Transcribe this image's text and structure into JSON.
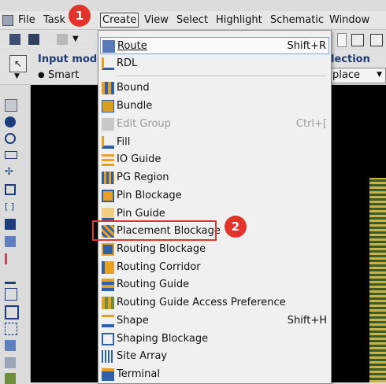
{
  "menubar": {
    "items": [
      "File",
      "Task",
      "Create",
      "View",
      "Select",
      "Highlight",
      "Schematic",
      "Window"
    ],
    "active": "Create"
  },
  "toolbar": {
    "input_mode_label": "Input mode",
    "input_mode_value": "Smart",
    "selection_label": "lection",
    "selection_value": "place"
  },
  "menu": {
    "items": [
      {
        "label": "Route",
        "shortcut": "Shift+R",
        "icon": "route-icon",
        "mnemonic": "R"
      },
      {
        "label": "RDL",
        "shortcut": "",
        "icon": "rdl-icon",
        "mnemonic": "R"
      },
      {
        "label": "Bound",
        "shortcut": "",
        "icon": "bound-icon",
        "mnemonic": "B"
      },
      {
        "label": "Bundle",
        "shortcut": "",
        "icon": "bundle-icon",
        "mnemonic": "B"
      },
      {
        "label": "Edit Group",
        "shortcut": "Ctrl+[",
        "icon": "edit-group-icon",
        "disabled": true
      },
      {
        "label": "Fill",
        "shortcut": "",
        "icon": "fill-icon"
      },
      {
        "label": "IO Guide",
        "shortcut": "",
        "icon": "io-guide-icon"
      },
      {
        "label": "PG Region",
        "shortcut": "",
        "icon": "pg-region-icon"
      },
      {
        "label": "Pin Blockage",
        "shortcut": "",
        "icon": "pin-blockage-icon"
      },
      {
        "label": "Pin Guide",
        "shortcut": "",
        "icon": "pin-guide-icon"
      },
      {
        "label": "Placement Blockage",
        "shortcut": "",
        "icon": "placement-blockage-icon"
      },
      {
        "label": "Routing Blockage",
        "shortcut": "",
        "icon": "routing-blockage-icon"
      },
      {
        "label": "Routing Corridor",
        "shortcut": "",
        "icon": "routing-corridor-icon"
      },
      {
        "label": "Routing Guide",
        "shortcut": "",
        "icon": "routing-guide-icon"
      },
      {
        "label": "Routing Guide Access Preference",
        "shortcut": "",
        "icon": "routing-guide-access-icon"
      },
      {
        "label": "Shape",
        "shortcut": "Shift+H",
        "icon": "shape-icon"
      },
      {
        "label": "Shaping Blockage",
        "shortcut": "",
        "icon": "shaping-blockage-icon"
      },
      {
        "label": "Site Array",
        "shortcut": "",
        "icon": "site-array-icon"
      },
      {
        "label": "Terminal",
        "shortcut": "",
        "icon": "terminal-icon"
      }
    ]
  },
  "annotations": {
    "step1": "1",
    "step2": "2"
  },
  "colors": {
    "annotation": "#e3342b",
    "canvas": "#000000",
    "highlight_border": "#7f9fd6"
  }
}
